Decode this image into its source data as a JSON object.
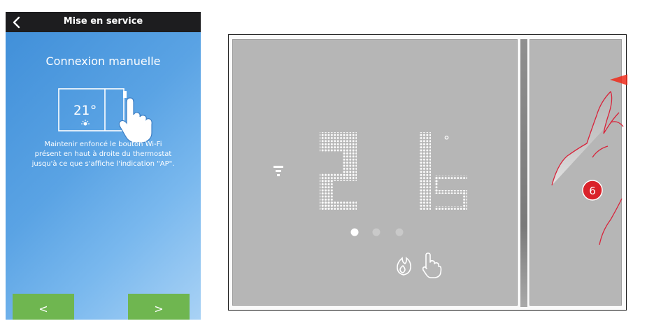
{
  "phone": {
    "header_title": "Mise en service",
    "screen_title": "Connexion manuelle",
    "mini_thermostat_temperature": "21°",
    "instruction_lines": [
      "Maintenir enfoncé le bouton Wi-Fi",
      "présent en haut à droite du thermostat",
      "jusqu'à ce que s'affiche l'indication \"AP\"."
    ],
    "prev_label": "<",
    "next_label": ">"
  },
  "thermostat": {
    "temperature_display": "21",
    "degree_symbol": "°",
    "page_dots": 3,
    "active_dot_index": 0,
    "mode_icons": [
      "flame-icon",
      "hand-icon"
    ],
    "wifi_icon": "wifi-icon"
  },
  "overlay": {
    "step_badge": "6",
    "arrow": "left",
    "badge_color": "#d9222a",
    "arrow_color": "#e03a22"
  },
  "colors": {
    "phone_header": "#1d1d1f",
    "phone_bg": "#4f9be0",
    "nav_button": "#6fb650",
    "thermostat_face": "#b6b6b6"
  }
}
